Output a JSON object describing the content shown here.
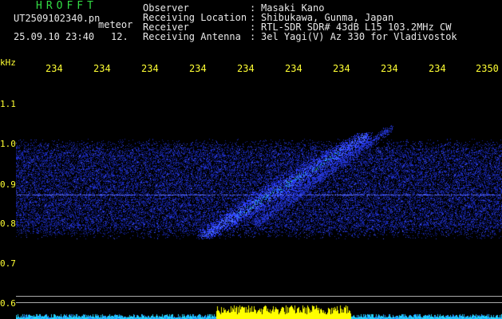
{
  "colors": {
    "brand": "#33dd44",
    "info": "#e8e8e8",
    "axis": "#ffff33",
    "signal": "#3a4cff",
    "band_yellow": "#ffff00",
    "band_cyan": "#22d6ff"
  },
  "header": {
    "brand": "HROFFT",
    "filename": "UT2509102340.pn",
    "tag": "meteor",
    "timestamp": "25.09.10 23:40",
    "counter": "12.",
    "meta": [
      {
        "label": "Observer",
        "sep": ":",
        "value": "Masaki Kano"
      },
      {
        "label": "Receiving Location",
        "sep": ":",
        "value": "Shibukawa, Gunma, Japan"
      },
      {
        "label": "Receiver",
        "sep": ":",
        "value": "RTL-SDR SDR# 43dB L15 103.2MHz CW"
      },
      {
        "label": "Receiving Antenna",
        "sep": ":",
        "value": "3el Yagi(V) Az 330 for Vladivostok"
      }
    ]
  },
  "axis": {
    "unit": "kHz",
    "y_ticks": [
      "1.1",
      "1.0",
      "0.9",
      "0.8",
      "0.7",
      "0.6"
    ],
    "x_ticks": [
      "234",
      "234",
      "234",
      "234",
      "234",
      "234",
      "234",
      "234",
      "234",
      "2350"
    ]
  }
}
